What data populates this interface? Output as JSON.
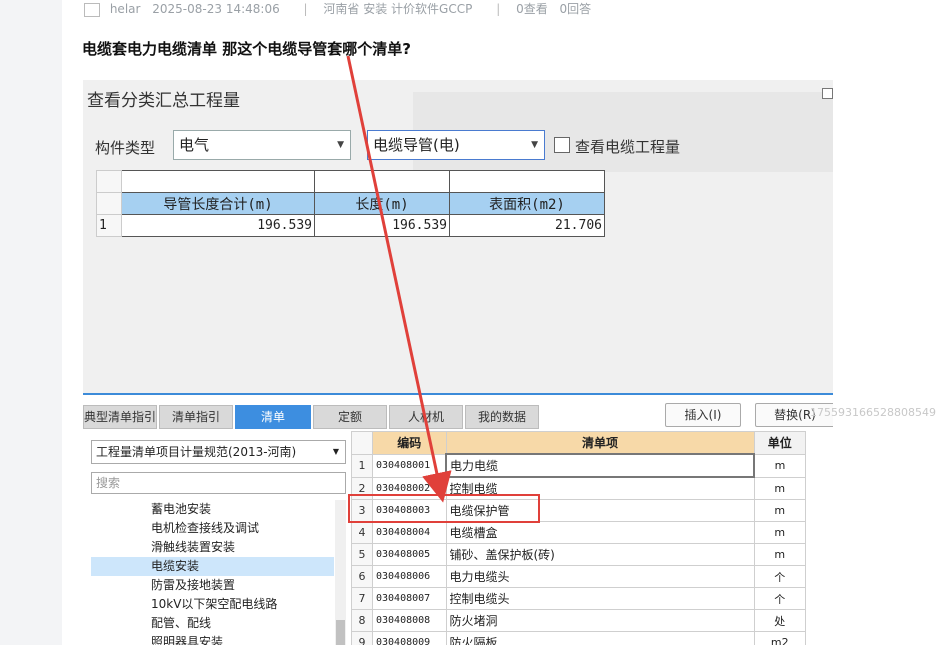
{
  "post": {
    "author": "helar",
    "datetime": "2025-08-23 14:48:06",
    "tags": "河南省 安装 计价软件GCCP",
    "views": "0查看",
    "answers": "0回答",
    "title": "电缆套电力电缆清单 那这个电缆导管套哪个清单?"
  },
  "dialog": {
    "title": "查看分类汇总工程量",
    "type_label": "构件类型",
    "type_value": "电气",
    "subtype_value": "电缆导管(电)",
    "check_label": "查看电缆工程量",
    "summary_headers": [
      "导管长度合计(m)",
      "长度(m)",
      "表面积(m2)"
    ],
    "summary_row_no": "1",
    "summary_values": [
      "196.539",
      "196.539",
      "21.706"
    ]
  },
  "tabs": [
    "典型清单指引",
    "清单指引",
    "清单",
    "定额",
    "人材机",
    "我的数据"
  ],
  "buttons": {
    "insert": "插入(I)",
    "replace": "替换(R)"
  },
  "watermark_id": "1755931665288085496",
  "left_panel": {
    "select_value": "工程量清单项目计量规范(2013-河南)",
    "search_placeholder": "搜索",
    "tree_items": [
      "蓄电池安装",
      "电机检查接线及调试",
      "滑触线装置安装",
      "电缆安装",
      "防雷及接地装置",
      "10kV以下架空配电线路",
      "配管、配线",
      "照明器具安装"
    ],
    "selected_index": 3
  },
  "grid": {
    "headers": [
      "编码",
      "清单项",
      "单位"
    ],
    "rows": [
      {
        "no": "1",
        "code": "030408001",
        "name": "电力电缆",
        "unit": "m"
      },
      {
        "no": "2",
        "code": "030408002",
        "name": "控制电缆",
        "unit": "m"
      },
      {
        "no": "3",
        "code": "030408003",
        "name": "电缆保护管",
        "unit": "m"
      },
      {
        "no": "4",
        "code": "030408004",
        "name": "电缆槽盒",
        "unit": "m"
      },
      {
        "no": "5",
        "code": "030408005",
        "name": "铺砂、盖保护板(砖)",
        "unit": "m"
      },
      {
        "no": "6",
        "code": "030408006",
        "name": "电力电缆头",
        "unit": "个"
      },
      {
        "no": "7",
        "code": "030408007",
        "name": "控制电缆头",
        "unit": "个"
      },
      {
        "no": "8",
        "code": "030408008",
        "name": "防火堵洞",
        "unit": "处"
      },
      {
        "no": "9",
        "code": "030408009",
        "name": "防火隔板",
        "unit": "m2"
      }
    ]
  },
  "colors": {
    "annotation": "#e0403a",
    "accent": "#3d8ee0",
    "header_blue": "#a6d0f1",
    "header_orange": "#f7d9a8"
  }
}
